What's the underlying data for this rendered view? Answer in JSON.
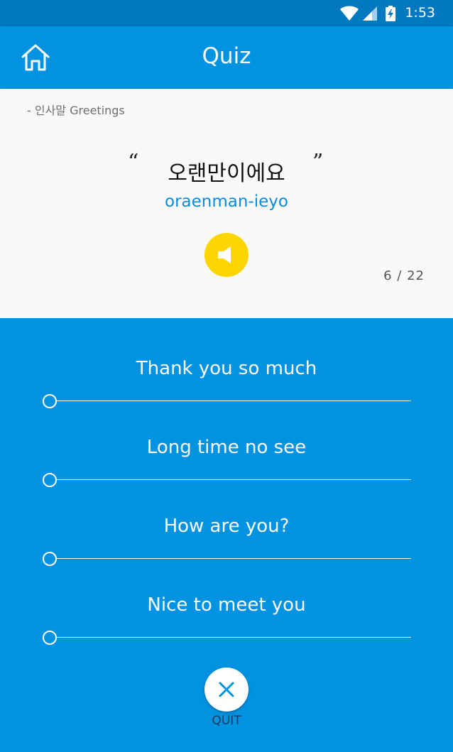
{
  "status_bar": {
    "time": "1:53",
    "icons": [
      "wifi-icon",
      "cell-signal-icon",
      "battery-icon"
    ]
  },
  "app_bar": {
    "title": "Quiz",
    "home_icon": "home-icon"
  },
  "question": {
    "category": "- 인사말 Greetings",
    "quote_open": "“",
    "quote_close": "”",
    "korean": "오랜만이에요",
    "romanization": "oraenman-ieyo",
    "speaker_icon": "speaker-icon",
    "counter": "6 / 22"
  },
  "options": [
    {
      "label": "Thank you so much"
    },
    {
      "label": "Long time no see"
    },
    {
      "label": "How are you?"
    },
    {
      "label": "Nice to meet you"
    }
  ],
  "quit": {
    "label": "QUIT",
    "icon": "close-icon"
  },
  "colors": {
    "primary": "#0193E1",
    "status_bar": "#0178C0",
    "accent": "#FFD500",
    "card_background": "#F9F9F9",
    "romanization": "#0A8BDB"
  }
}
